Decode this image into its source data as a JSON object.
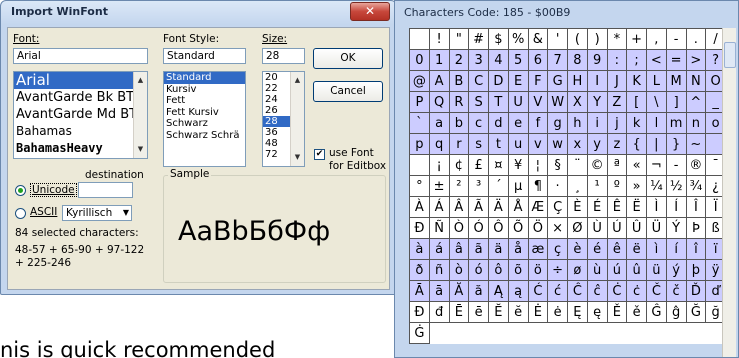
{
  "dialog": {
    "title": "Import WinFont",
    "font_label": "Font:",
    "font_value": "Arial",
    "font_list": [
      "Arial",
      "AvantGarde Bk BT",
      "AvantGarde Md BT",
      "Bahamas",
      "BahamasHeavy"
    ],
    "style_label": "Font Style:",
    "style_value": "Standard",
    "style_list": [
      "Standard",
      "Kursiv",
      "Fett",
      "Fett Kursiv",
      "Schwarz",
      "Schwarz Schrä"
    ],
    "size_label": "Size:",
    "size_value": "28",
    "size_list": [
      "20",
      "22",
      "24",
      "26",
      "28",
      "36",
      "48",
      "72"
    ],
    "ok": "OK",
    "cancel": "Cancel",
    "use_font_label": "use Font for Editbox",
    "destination_label": "destination",
    "unicode_label": "Unicode",
    "ascii_label": "ASCII",
    "ascii_select": "Kyrillisch",
    "selected_count": "84 selected characters:",
    "ranges": "48-57 + 65-90 + 97-122 + 225-246",
    "sample_label": "Sample",
    "sample_text": "AaBbБбФф"
  },
  "chars": {
    "title": "Characters  Code: 185 - $00B9",
    "rows": [
      [
        " ",
        "!",
        "\"",
        "#",
        "$",
        "%",
        "&",
        "'",
        "(",
        ")",
        "*",
        "+",
        ",",
        "-",
        ".",
        "/"
      ],
      [
        "0",
        "1",
        "2",
        "3",
        "4",
        "5",
        "6",
        "7",
        "8",
        "9",
        ":",
        ";",
        "<",
        "=",
        ">",
        "?"
      ],
      [
        "@",
        "A",
        "B",
        "C",
        "D",
        "E",
        "F",
        "G",
        "H",
        "I",
        "J",
        "K",
        "L",
        "M",
        "N",
        "O"
      ],
      [
        "P",
        "Q",
        "R",
        "S",
        "T",
        "U",
        "V",
        "W",
        "X",
        "Y",
        "Z",
        "[",
        "\\",
        "]",
        "^",
        "_"
      ],
      [
        "`",
        "a",
        "b",
        "c",
        "d",
        "e",
        "f",
        "g",
        "h",
        "i",
        "j",
        "k",
        "l",
        "m",
        "n",
        "o"
      ],
      [
        "p",
        "q",
        "r",
        "s",
        "t",
        "u",
        "v",
        "w",
        "x",
        "y",
        "z",
        "{",
        "|",
        "}",
        "~",
        " "
      ],
      [
        " ",
        "¡",
        "¢",
        "£",
        "¤",
        "¥",
        "¦",
        "§",
        "¨",
        "©",
        "ª",
        "«",
        "¬",
        "-",
        "®",
        "¯"
      ],
      [
        "°",
        "±",
        "²",
        "³",
        "´",
        "µ",
        "¶",
        "·",
        "¸",
        "¹",
        "º",
        "»",
        "¼",
        "½",
        "¾",
        "¿"
      ],
      [
        "À",
        "Á",
        "Â",
        "Ã",
        "Ä",
        "Å",
        "Æ",
        "Ç",
        "È",
        "É",
        "Ê",
        "Ë",
        "Ì",
        "Í",
        "Î",
        "Ï"
      ],
      [
        "Ð",
        "Ñ",
        "Ò",
        "Ó",
        "Ô",
        "Õ",
        "Ö",
        "×",
        "Ø",
        "Ù",
        "Ú",
        "Û",
        "Ü",
        "Ý",
        "Þ",
        "ß"
      ],
      [
        "à",
        "á",
        "â",
        "ã",
        "ä",
        "å",
        "æ",
        "ç",
        "è",
        "é",
        "ê",
        "ë",
        "ì",
        "í",
        "î",
        "ï"
      ],
      [
        "ð",
        "ñ",
        "ò",
        "ó",
        "ô",
        "õ",
        "ö",
        "÷",
        "ø",
        "ù",
        "ú",
        "û",
        "ü",
        "ý",
        "þ",
        "ÿ"
      ],
      [
        "Ā",
        "ā",
        "Ă",
        "ă",
        "Ą",
        "ą",
        "Ć",
        "ć",
        "Ĉ",
        "ĉ",
        "Ċ",
        "ċ",
        "Č",
        "č",
        "Ď",
        "ď"
      ],
      [
        "Đ",
        "đ",
        "Ē",
        "ē",
        "Ĕ",
        "ĕ",
        "Ė",
        "ė",
        "Ę",
        "ę",
        "Ě",
        "ě",
        "Ĝ",
        "ĝ",
        "Ğ",
        "ğ"
      ],
      [
        "Ġ"
      ]
    ],
    "highlight_rows": [
      1,
      2,
      3,
      4,
      5,
      10,
      11,
      12
    ]
  },
  "background_text": "nis is quick recommended"
}
